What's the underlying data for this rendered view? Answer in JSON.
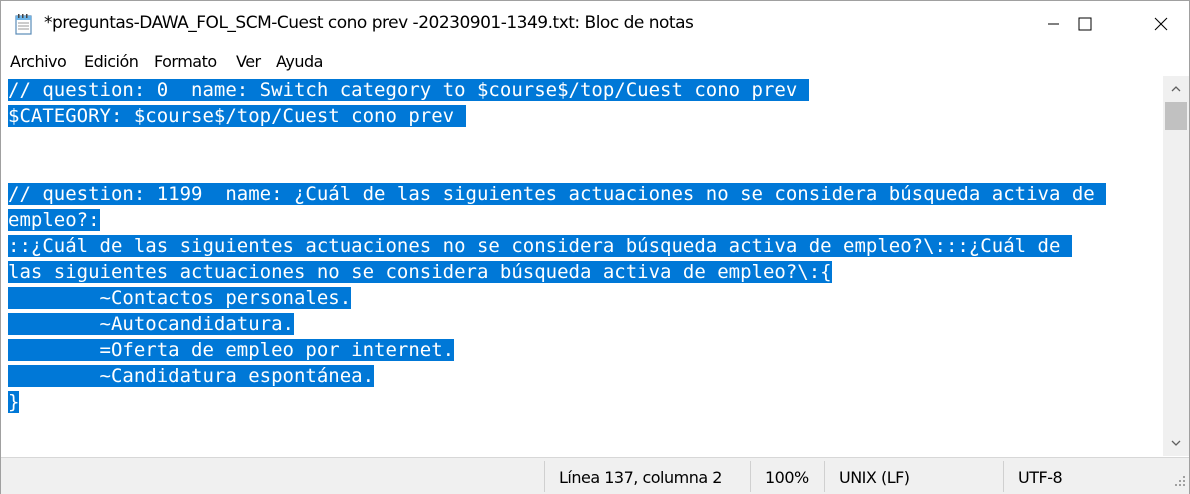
{
  "window": {
    "title": "*preguntas-DAWA_FOL_SCM-Cuest cono prev -20230901-1349.txt: Bloc de notas",
    "app_icon": "notepad-icon",
    "controls": {
      "minimize": "minimize-icon",
      "maximize": "maximize-icon",
      "close": "close-icon"
    }
  },
  "menu": {
    "items": [
      "Archivo",
      "Edición",
      "Formato",
      "Ver",
      "Ayuda"
    ]
  },
  "editor": {
    "selection_color": "#0078d7",
    "lines": [
      "// question: 0  name: Switch category to $course$/top/Cuest cono prev ",
      "$CATEGORY: $course$/top/Cuest cono prev ",
      "",
      "",
      "// question: 1199  name: ¿Cuál de las siguientes actuaciones no se considera búsqueda activa de ",
      "empleo?:",
      "::¿Cuál de las siguientes actuaciones no se considera búsqueda activa de empleo?\\:::¿Cuál de ",
      "las siguientes actuaciones no se considera búsqueda activa de empleo?\\:{",
      "        ~Contactos personales.",
      "        ~Autocandidatura.",
      "        =Oferta de empleo por internet.",
      "        ~Candidatura espontánea.",
      "}"
    ]
  },
  "scrollbar": {
    "up_icon": "scroll-up-arrow-icon",
    "down_icon": "scroll-down-arrow-icon"
  },
  "status": {
    "position": "Línea 137, columna 2",
    "zoom": "100%",
    "line_ending": "UNIX (LF)",
    "encoding": "UTF-8"
  }
}
